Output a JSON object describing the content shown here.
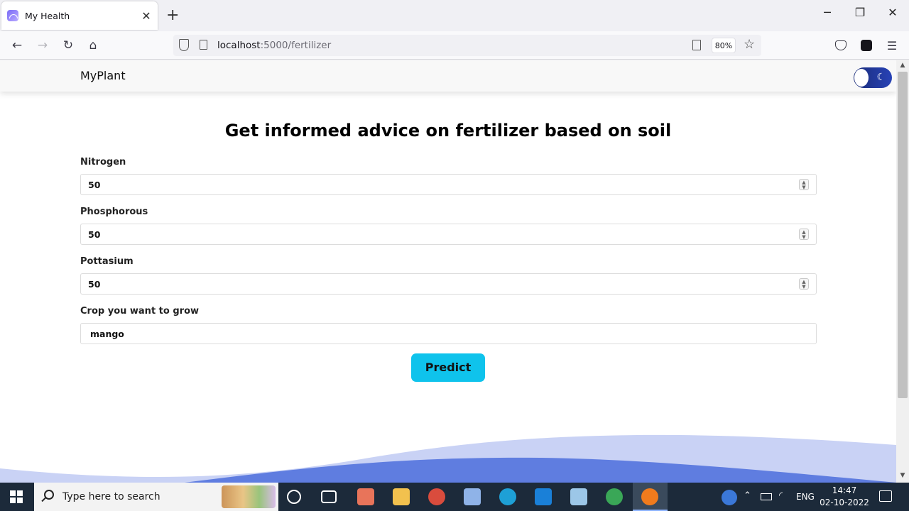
{
  "browser": {
    "tab_title": "My Health",
    "tab_close": "✕",
    "new_tab": "+",
    "url_host": "localhost",
    "url_rest": ":5000/fertilizer",
    "zoom": "80%",
    "window": {
      "minimize": "─",
      "restore": "❐",
      "close": "✕"
    }
  },
  "site": {
    "brand": "MyPlant",
    "theme_toggle_icon": "☾",
    "heading": "Get informed advice on fertilizer based on soil",
    "fields": [
      {
        "label": "Nitrogen",
        "value": "50"
      },
      {
        "label": "Phosphorous",
        "value": "50"
      },
      {
        "label": "Pottasium",
        "value": "50"
      },
      {
        "label": "Crop you want to grow",
        "value": "mango"
      }
    ],
    "predict_label": "Predict"
  },
  "taskbar": {
    "search_placeholder": "Type here to search",
    "tray_lang": "ENG",
    "time": "14:47",
    "date": "02-10-2022"
  },
  "colors": {
    "accent_button": "#0fc3ec",
    "toggle": "#2742b6",
    "wave_light": "#c9d2f5",
    "wave_dark": "#5f7de0"
  }
}
